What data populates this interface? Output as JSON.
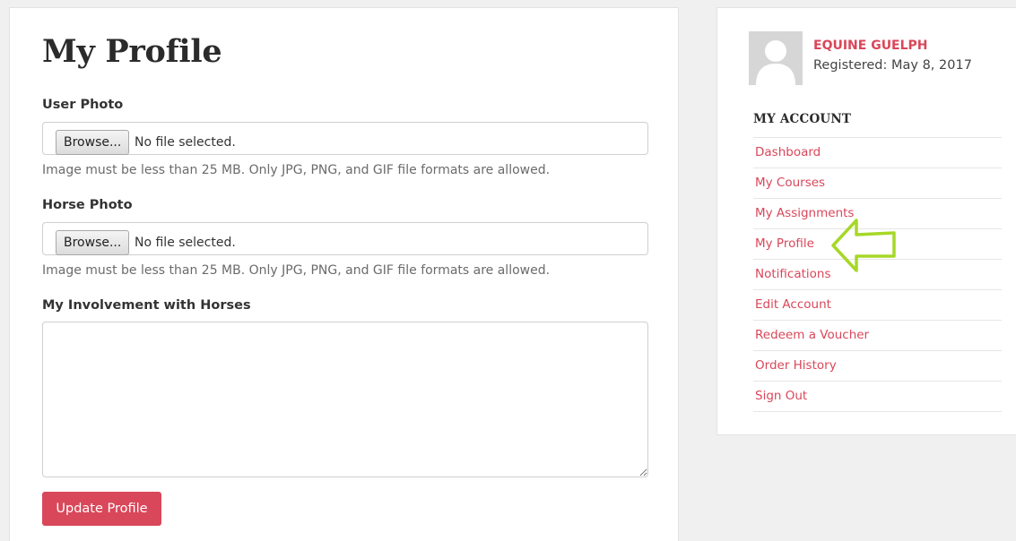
{
  "main": {
    "title": "My Profile",
    "user_photo": {
      "label": "User Photo",
      "browse_label": "Browse...",
      "status": "No file selected.",
      "help": "Image must be less than 25 MB. Only JPG, PNG, and GIF file formats are allowed."
    },
    "horse_photo": {
      "label": "Horse Photo",
      "browse_label": "Browse...",
      "status": "No file selected.",
      "help": "Image must be less than 25 MB. Only JPG, PNG, and GIF file formats are allowed."
    },
    "involvement": {
      "label": "My Involvement with Horses",
      "value": ""
    },
    "update_button_label": "Update Profile"
  },
  "sidebar": {
    "user": {
      "name": "EQUINE GUELPH",
      "registered": "Registered: May 8, 2017",
      "avatar_icon": "default-avatar-icon"
    },
    "section_heading": "MY ACCOUNT",
    "items": [
      {
        "label": "Dashboard"
      },
      {
        "label": "My Courses"
      },
      {
        "label": "My Assignments"
      },
      {
        "label": "My Profile"
      },
      {
        "label": "Notifications"
      },
      {
        "label": "Edit Account"
      },
      {
        "label": "Redeem a Voucher"
      },
      {
        "label": "Order History"
      },
      {
        "label": "Sign Out"
      }
    ]
  },
  "annotation": {
    "arrow_icon": "left-arrow-outline-icon",
    "arrow_color": "#a6d827"
  },
  "colors": {
    "accent": "#d9475a",
    "background": "#f0f0f0",
    "card": "#ffffff"
  }
}
